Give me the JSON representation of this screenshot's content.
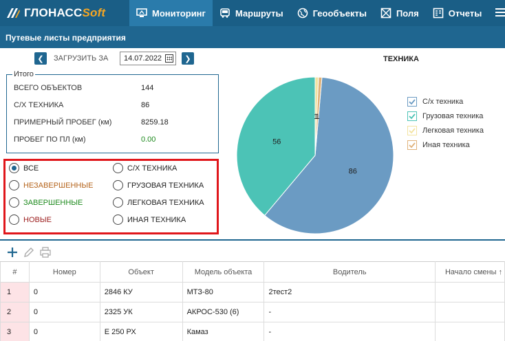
{
  "nav": {
    "logo_main": "ГЛОНАСС",
    "logo_soft": "Soft",
    "items": [
      {
        "label": "Мониторинг",
        "icon": "monitor-icon",
        "active": true
      },
      {
        "label": "Маршруты",
        "icon": "bus-icon",
        "active": false
      },
      {
        "label": "Геообъекты",
        "icon": "globe-icon",
        "active": false
      },
      {
        "label": "Поля",
        "icon": "field-icon",
        "active": false
      },
      {
        "label": "Отчеты",
        "icon": "report-icon",
        "active": false
      }
    ],
    "menu_icon": "hamburger-icon"
  },
  "page": {
    "title": "Путевые листы предприятия",
    "load_label": "ЗАГРУЗИТЬ ЗА",
    "date_value": "14.07.2022",
    "chart_title": "ТЕХНИКА"
  },
  "summary": {
    "legend": "Итого",
    "rows": [
      {
        "label": "ВСЕГО ОБЪЕКТОВ",
        "value": "144"
      },
      {
        "label": "С/Х ТЕХНИКА",
        "value": "86"
      },
      {
        "label": "ПРИМЕРНЫЙ ПРОБЕГ (км)",
        "value": "8259.18"
      },
      {
        "label": "ПРОБЕГ ПО ПЛ (км)",
        "value": "0.00"
      }
    ]
  },
  "filters": {
    "left": [
      {
        "label": "ВСЕ",
        "selected": true,
        "color": "#222222"
      },
      {
        "label": "НЕЗАВЕРШЕННЫЕ",
        "selected": false,
        "color": "#b5651d"
      },
      {
        "label": "ЗАВЕРШЕННЫЕ",
        "selected": false,
        "color": "#1e8a1e"
      },
      {
        "label": "НОВЫЕ",
        "selected": false,
        "color": "#9b1c1c"
      }
    ],
    "right": [
      {
        "label": "С/Х ТЕХНИКА",
        "selected": false
      },
      {
        "label": "ГРУЗОВАЯ ТЕХНИКА",
        "selected": false
      },
      {
        "label": "ЛЕГКОВАЯ ТЕХНИКА",
        "selected": false
      },
      {
        "label": "ИНАЯ ТЕХНИКА",
        "selected": false
      }
    ]
  },
  "chart_data": {
    "type": "pie",
    "title": "ТЕХНИКА",
    "categories": [
      "С/х техника",
      "Грузовая техника",
      "Легковая техника",
      "Иная техника"
    ],
    "values": [
      86,
      56,
      1,
      1
    ],
    "labels": [
      "86",
      "56",
      "1",
      "1"
    ],
    "colors": [
      "#6b9bc3",
      "#4cc3b6",
      "#f3e3a0",
      "#e0b27a"
    ],
    "legend_position": "right",
    "legend_checked": [
      true,
      true,
      true,
      true
    ]
  },
  "toolbar": {
    "icons": [
      "add-icon",
      "edit-icon",
      "print-icon"
    ]
  },
  "table": {
    "columns": [
      "#",
      "Номер",
      "Объект",
      "Модель объекта",
      "Водитель",
      "Начало смены ↑"
    ],
    "rows": [
      [
        "1",
        "0",
        "2846 КУ",
        "МТЗ-80",
        "2тест2",
        ""
      ],
      [
        "2",
        "0",
        "2325 УК",
        "АКРОС-530 (6)",
        "-",
        ""
      ],
      [
        "3",
        "0",
        "Е 250 РХ",
        "Камаз",
        "-",
        ""
      ]
    ]
  }
}
